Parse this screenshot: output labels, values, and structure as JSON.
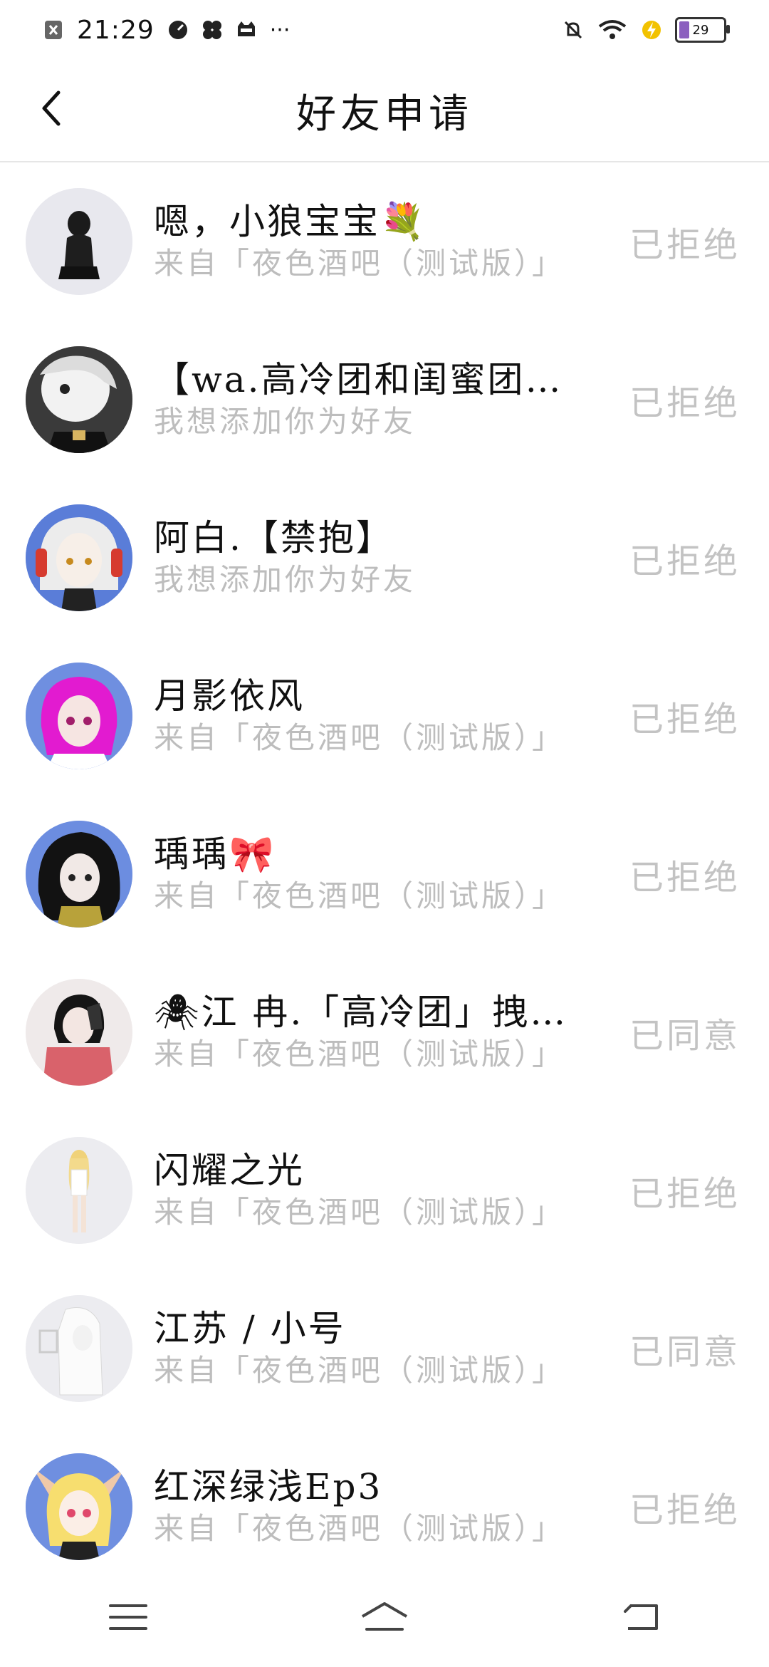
{
  "status_bar": {
    "time": "21:29",
    "battery": "29",
    "ellipsis": "···"
  },
  "header": {
    "title": "好友申请"
  },
  "requests": [
    {
      "name": "嗯，小狼宝宝💐",
      "message": "来自「夜色酒吧（测试版）」",
      "status": "已拒绝",
      "avatar_bg": "#e8e8ee"
    },
    {
      "name": "【wa.高冷团和闺蜜团😎】",
      "message": "我想添加你为好友",
      "status": "已拒绝",
      "avatar_bg": "#2b2b2b"
    },
    {
      "name": "阿白.【禁抱】",
      "message": "我想添加你为好友",
      "status": "已拒绝",
      "avatar_bg": "#5a7dd8"
    },
    {
      "name": "月影依风",
      "message": "来自「夜色酒吧（测试版）」",
      "status": "已拒绝",
      "avatar_bg": "#6f8fe0"
    },
    {
      "name": "瑀瑀🎀",
      "message": "来自「夜色酒吧（测试版）」",
      "status": "已拒绝",
      "avatar_bg": "#6c8de0"
    },
    {
      "name": "🕷江 冉.「高冷团」拽…",
      "message": "来自「夜色酒吧（测试版）」",
      "status": "已同意",
      "avatar_bg": "#efeaea"
    },
    {
      "name": "闪耀之光",
      "message": "来自「夜色酒吧（测试版）」",
      "status": "已拒绝",
      "avatar_bg": "#ececf0"
    },
    {
      "name": "江苏 / 小号",
      "message": "来自「夜色酒吧（测试版）」",
      "status": "已同意",
      "avatar_bg": "#ececf0"
    },
    {
      "name": "红深绿浅Ep3",
      "message": "来自「夜色酒吧（测试版）」",
      "status": "已拒绝",
      "avatar_bg": "#6f8fe0"
    }
  ],
  "colors": {
    "status_text": "#c3c3c3",
    "sub_text": "#bdbdbd",
    "divider": "#e6e6e6"
  }
}
